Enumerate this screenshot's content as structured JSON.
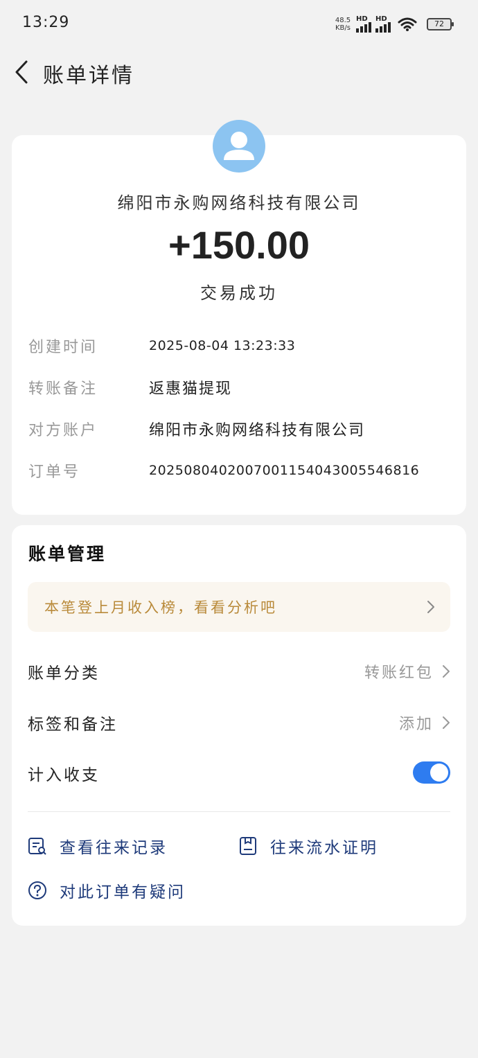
{
  "status_bar": {
    "time": "13:29",
    "net_speed_value": "48.5",
    "net_speed_unit": "KB/s",
    "signal_tag": "HD",
    "battery": "72"
  },
  "nav": {
    "title": "账单详情",
    "back_icon": "chevron-left-icon"
  },
  "summary": {
    "payee": "绵阳市永购网络科技有限公司",
    "amount": "+150.00",
    "status": "交易成功",
    "avatar_color": "#8cc4f1",
    "details": [
      {
        "label": "创建时间",
        "value": "2025-08-04 13:23:33"
      },
      {
        "label": "转账备注",
        "value": "返惠猫提现"
      },
      {
        "label": "对方账户",
        "value": "绵阳市永购网络科技有限公司"
      },
      {
        "label": "订单号",
        "value": "2025080402007001154043005546816"
      }
    ]
  },
  "management": {
    "title": "账单管理",
    "promo": "本笔登上月收入榜，看看分析吧",
    "category_label": "账单分类",
    "category_value": "转账红包",
    "tags_label": "标签和备注",
    "tags_value": "添加",
    "include_label": "计入收支",
    "include_enabled": true,
    "links": [
      {
        "label": "查看往来记录",
        "icon": "record-list-icon"
      },
      {
        "label": "往来流水证明",
        "icon": "certificate-icon"
      },
      {
        "label": "对此订单有疑问",
        "icon": "question-icon"
      }
    ]
  },
  "colors": {
    "accent": "#2e7cf0",
    "link": "#1e3a7a",
    "promo_text": "#b98a3a",
    "promo_bg": "#faf6ef"
  }
}
